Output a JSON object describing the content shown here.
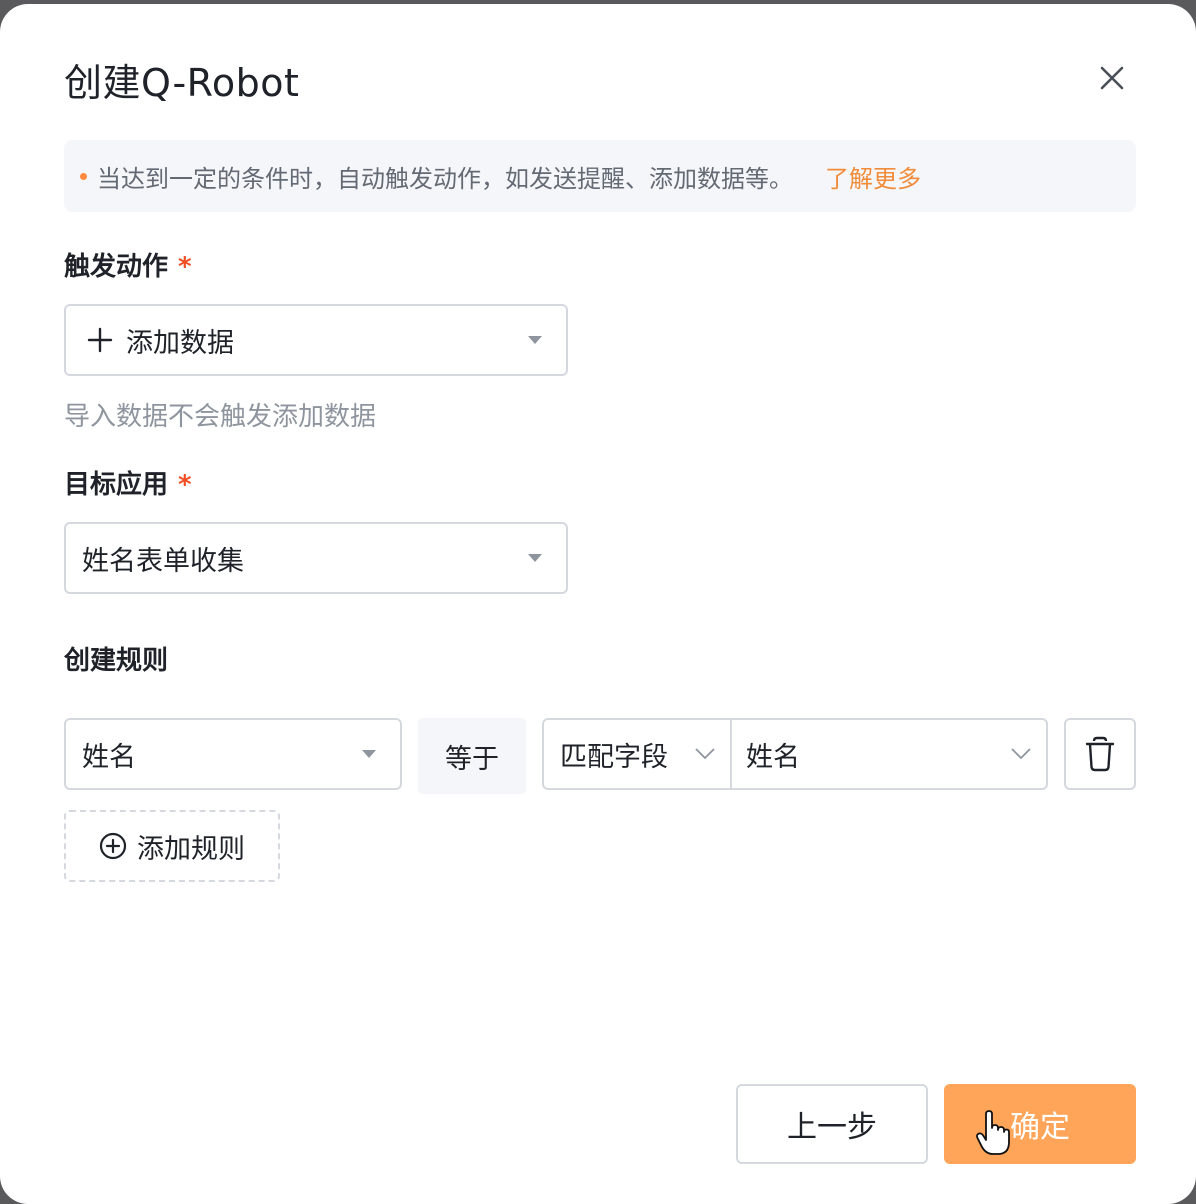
{
  "dialog": {
    "title": "创建Q-Robot"
  },
  "banner": {
    "text": "当达到一定的条件时，自动触发动作，如发送提醒、添加数据等。",
    "link": "了解更多"
  },
  "trigger": {
    "label": "触发动作",
    "required_mark": "*",
    "value": "添加数据",
    "hint": "导入数据不会触发添加数据"
  },
  "target": {
    "label": "目标应用",
    "required_mark": "*",
    "value": "姓名表单收集"
  },
  "rules": {
    "label": "创建规则",
    "field": "姓名",
    "operator": "等于",
    "match_type": "匹配字段",
    "match_value": "姓名",
    "add_label": "添加规则"
  },
  "footer": {
    "prev_label": "上一步",
    "ok_label": "确定"
  },
  "colors": {
    "accent": "#ffa559",
    "link": "#f08c3a",
    "required": "#f04e23",
    "banner_bg": "#f5f6fa"
  },
  "icons": {
    "close": "close-icon",
    "plus": "plus-icon",
    "caret": "caret-down-icon",
    "chevron": "chevron-down-icon",
    "trash": "trash-icon",
    "add_circle": "plus-circle-icon",
    "cursor": "hand-pointer-icon"
  }
}
